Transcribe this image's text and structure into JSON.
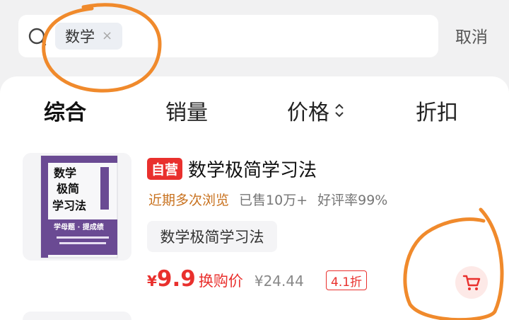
{
  "search": {
    "chip_text": "数学",
    "chip_close": "×",
    "cancel_label": "取消"
  },
  "tabs": [
    {
      "label": "综合",
      "active": true
    },
    {
      "label": "销量",
      "active": false
    },
    {
      "label": "价格",
      "active": false,
      "icon": "sort-updown-icon"
    },
    {
      "label": "折扣",
      "active": false
    }
  ],
  "product": {
    "badge": "自营",
    "title": "数学极简学习法",
    "meta": {
      "recent": "近期多次浏览",
      "sold": "已售10万+",
      "rating": "好评率99%"
    },
    "tag": "数学极简学习法",
    "price_currency": "¥",
    "price_value": "9.9",
    "price_label": "换购价",
    "original_price": "¥24.44",
    "discount": "4.1折",
    "cart_icon": "cart-icon",
    "cover": {
      "title_line1": "数学",
      "title_line2": "极简",
      "title_line3": "学习法",
      "tagline": "学母题 · 提成绩"
    }
  },
  "colors": {
    "accent_red": "#e9302d",
    "meta_orange": "#c8711e",
    "annotation_orange": "#f08a2c",
    "cover_purple": "#6a4a93"
  }
}
